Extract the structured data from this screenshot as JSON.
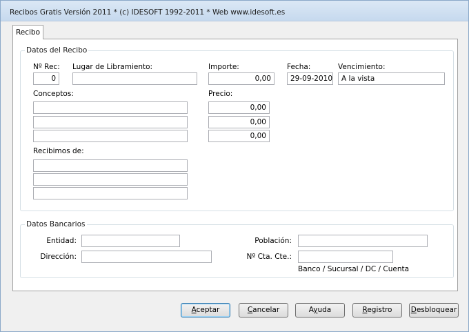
{
  "window": {
    "title": "Recibos Gratis  Versión 2011  * (c) IDESOFT 1992-2011  * Web www.idesoft.es"
  },
  "tabs": [
    {
      "label": "Recibo"
    }
  ],
  "datos_recibo": {
    "legend": "Datos del Recibo",
    "num_rec": {
      "label": "Nº Rec:",
      "value": "0"
    },
    "lugar": {
      "label": "Lugar de Libramiento:",
      "value": ""
    },
    "importe": {
      "label": "Importe:",
      "value": "0,00"
    },
    "fecha": {
      "label": "Fecha:",
      "value": "29-09-2010"
    },
    "vencimiento": {
      "label": "Vencimiento:",
      "value": "A la vista"
    },
    "conceptos": {
      "label": "Conceptos:",
      "values": [
        "",
        "",
        ""
      ]
    },
    "precio": {
      "label": "Precio:",
      "values": [
        "0,00",
        "0,00",
        "0,00"
      ]
    },
    "recibimos": {
      "label": "Recibimos de:",
      "values": [
        "",
        "",
        ""
      ]
    }
  },
  "datos_bancarios": {
    "legend": "Datos Bancarios",
    "entidad": {
      "label": "Entidad:",
      "value": ""
    },
    "direccion": {
      "label": "Dirección:",
      "value": ""
    },
    "poblacion": {
      "label": "Población:",
      "value": ""
    },
    "cta": {
      "label": "Nº Cta. Cte.:",
      "value": "",
      "hint": "Banco / Sucursal / DC / Cuenta"
    }
  },
  "buttons": {
    "aceptar": {
      "mnemonic": "A",
      "rest": "ceptar"
    },
    "cancelar": {
      "mnemonic": "C",
      "rest": "ancelar"
    },
    "ayuda": {
      "pre": "A",
      "mnemonic": "y",
      "rest": "uda"
    },
    "registro": {
      "mnemonic": "R",
      "rest": "egistro"
    },
    "desbloquear": {
      "mnemonic": "D",
      "rest": "esbloquear"
    }
  }
}
